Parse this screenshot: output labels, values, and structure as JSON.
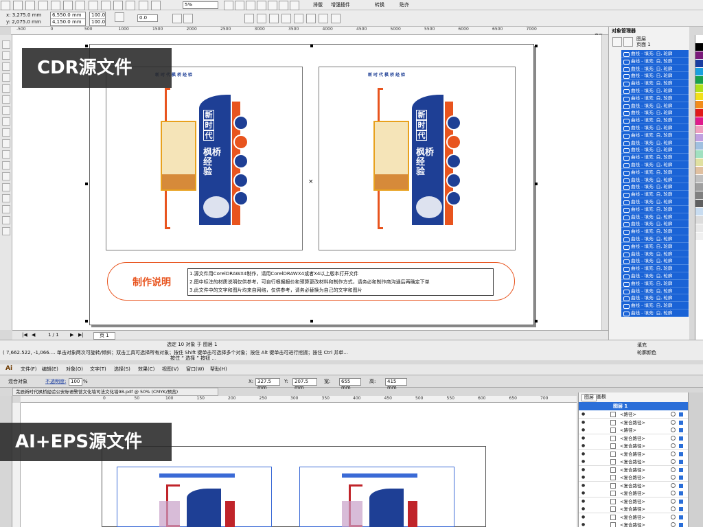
{
  "cdr": {
    "font_box": "5%",
    "layout_btn": "排版",
    "plugin_btn": "增强插件",
    "convert_btn": "转换",
    "paste_btn": "贴齐",
    "x": "x: 3,275.0 mm",
    "y": "y: 2,075.0 mm",
    "w": "6,550.0 mm",
    "h": "4,150.0 mm",
    "sx": "100.0",
    "sy": "100.0",
    "angle": "0.0",
    "ruler_ticks": [
      "-500",
      "0",
      "500",
      "1000",
      "1500",
      "2000",
      "2500",
      "3000",
      "3500",
      "4000",
      "4500",
      "5000",
      "5500",
      "6000",
      "6500",
      "7000"
    ],
    "ruler_unit": "毫米",
    "page_count": "1 / 1",
    "page_tab": "页 1",
    "status_line1": "选定 10 对象 于 图层 1",
    "status_line2": "( 7,662.522, -1,066.... 单击对象两次可旋转/倾斜；双击工具可选择所有对象；按住 Shift 键单击可选择多个对象；按住 Alt 键单击可进行挖掘；按住 Ctrl 并单...",
    "status_line3": "按住 “ 选择 ” 按钮 ...",
    "fill_label": "填充",
    "outline_label": "轮廓颜色",
    "obj_manager_title": "对象管理器",
    "obj_layer_name": "图层",
    "obj_page_name": "页面 1",
    "obj_items": [
      "曲线 - 填充: 白, 轮廓",
      "曲线 - 填充: 白, 轮廓",
      "曲线 - 填充: 白, 轮廓",
      "曲线 - 填充: 白, 轮廓",
      "曲线 - 填充: 白, 轮廓",
      "曲线 - 填充: 白, 轮廓",
      "曲线 - 填充: 白, 轮廓",
      "曲线 - 填充: 白, 轮廓",
      "曲线 - 填充: 白, 轮廓",
      "曲线 - 填充: 白, 轮廓",
      "曲线 - 填充: 白, 轮廓",
      "曲线 - 填充: 白, 轮廓",
      "曲线 - 填充: 白, 轮廓",
      "曲线 - 填充: 白, 轮廓",
      "曲线 - 填充: 白, 轮廓",
      "曲线 - 填充: 白, 轮廓",
      "曲线 - 填充: 白, 轮廓",
      "曲线 - 填充: 白, 轮廓",
      "曲线 - 填充: 白, 轮廓",
      "曲线 - 填充: 白, 轮廓",
      "曲线 - 填充: 白, 轮廓",
      "曲线 - 填充: 白, 轮廓",
      "曲线 - 填充: 白, 轮廓",
      "曲线 - 填充: 白, 轮廓",
      "曲线 - 填充: 白, 轮廓",
      "曲线 - 填充: 白, 轮廓",
      "曲线 - 填充: 白, 轮廓",
      "曲线 - 填充: 白, 轮廓",
      "曲线 - 填充: 白, 轮廓",
      "曲线 - 填充: 白, 轮廓",
      "曲线 - 填充: 白, 轮廓",
      "曲线 - 填充: 白, 轮廓",
      "曲线 - 填充: 白, 轮廓",
      "曲线 - 填充: 白, 轮廓",
      "曲线 - 填充: 白, 轮廓",
      "曲线 - 填充: 白, 轮廓"
    ],
    "sign_title_chars": [
      "新",
      "时",
      "代"
    ],
    "sign_body_chars": [
      "枫",
      "桥",
      "经",
      "验"
    ],
    "sign_header_text": "新时代枫桥经验",
    "notes_title": "制作说明",
    "notes": [
      "1.源文件用CorelDRAWX4制作，请用CorelDRAWX4或者X4以上版本打开文件",
      "2.图中标注的材质说明仅供参考，可自行根据报价和预算更改材料和制作方式，请务必和制作商沟通后再确定下单",
      "3.此文件中的文字和图片均来自网络，仅供参考，请务必替换为自己的文字和图片"
    ],
    "swatch_colors": [
      "#ffffff",
      "#000000",
      "#7a1a7a",
      "#1a3da0",
      "#1aa0e0",
      "#1aa04a",
      "#b0e01a",
      "#f2e01a",
      "#f28c1a",
      "#e01a1a",
      "#e01a8c",
      "#f0a0c0",
      "#c0a0e0",
      "#a0c0e0",
      "#a0e0c0",
      "#e0e0a0",
      "#e0c0a0",
      "#c0c0c0",
      "#a0a0a0",
      "#808080",
      "#606060",
      "#c8dcf0",
      "#dcdcdc",
      "#e8e8e8",
      "#f0f0f0",
      "#ffffff",
      "#ffffff",
      "#ffffff",
      "#ffffff",
      "#ffffff",
      "#ffffff",
      "#ffffff",
      "#ffffff",
      "#ffffff",
      "#ffffff",
      "#ffffff",
      "#ffffff"
    ]
  },
  "ai": {
    "menu": [
      "文件(F)",
      "编辑(E)",
      "对象(O)",
      "文字(T)",
      "选择(S)",
      "效果(C)",
      "视图(V)",
      "窗口(W)",
      "帮助(H)"
    ],
    "logo": "Ai",
    "mixed_label": "混合对象",
    "opacity_label": "不透明度:",
    "opacity_value": "100",
    "opacity_unit": "%",
    "x_label": "X:",
    "x_value": "327.5 mm",
    "y_label": "Y:",
    "y_value": "207.5 mm",
    "w_label": "宽:",
    "w_value": "655 mm",
    "h_label": "高:",
    "h_value": "415 mm",
    "doc_tab": "芜辰新时代枫桥经验公安标语警营文化墙司法文化墙98.pdf @ 50% (CMYK/预览)",
    "ruler_ticks": [
      "0",
      "50",
      "100",
      "150",
      "200",
      "250",
      "300",
      "350",
      "400",
      "450",
      "500",
      "550",
      "600",
      "650",
      "700"
    ],
    "panel_tabs": [
      "图层",
      "画板"
    ],
    "layer_name": "图层 1",
    "layer_items": [
      "<路径>",
      "<复合路径>",
      "<路径>",
      "<复合路径>",
      "<复合路径>",
      "<复合路径>",
      "<复合路径>",
      "<复合路径>",
      "<复合路径>",
      "<复合路径>",
      "<复合路径>",
      "<复合路径>",
      "<复合路径>",
      "<复合路径>",
      "<复合路径>"
    ]
  },
  "labels": {
    "cdr_label": "CDR源文件",
    "ai_label": "AI+EPS源文件"
  },
  "colors": {
    "accent_blue": "#1a63d6",
    "sign_blue": "#1e3f95",
    "sign_orange": "#e8541e",
    "selection_blue": "#1a63d6"
  }
}
